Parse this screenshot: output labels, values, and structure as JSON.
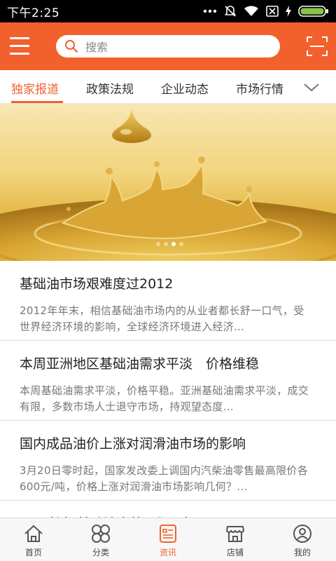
{
  "status_bar": {
    "time": "下午2:25"
  },
  "header": {
    "search_placeholder": "搜索"
  },
  "tabs": [
    {
      "label": "独家报道",
      "active": true
    },
    {
      "label": "政策法规",
      "active": false
    },
    {
      "label": "企业动态",
      "active": false
    },
    {
      "label": "市场行情",
      "active": false
    }
  ],
  "banner": {
    "dots": 4,
    "active_dot": 3
  },
  "news": [
    {
      "title": "基础油市场艰难度过2012",
      "summary": "2012年年末，相信基础油市场内的从业者都长舒一口气，受世界经济环境的影响，全球经济环境进入经济…"
    },
    {
      "title": "本周亚洲地区基础油需求平淡　价格维稳",
      "summary": "本周基础油需求平淡，价格平稳。亚洲基础油需求平淡，成交有限，多数市场人士退守市场，持观望态度…"
    },
    {
      "title": "国内成品油价上涨对润滑油市场的影响",
      "summary": "3月20日零时起，国家发改委上调国内汽柴油零售最高限价各600元/吨，价格上涨对润滑油市场影响几何？…"
    },
    {
      "title": "开局利空 基础油走势一蹶不振",
      "summary": ""
    }
  ],
  "bottom_nav": [
    {
      "label": "首页",
      "icon": "home-icon",
      "active": false
    },
    {
      "label": "分类",
      "icon": "category-icon",
      "active": false
    },
    {
      "label": "资讯",
      "icon": "news-icon",
      "active": true
    },
    {
      "label": "店铺",
      "icon": "store-icon",
      "active": false
    },
    {
      "label": "我的",
      "icon": "profile-icon",
      "active": false
    }
  ],
  "colors": {
    "accent": "#f2612d",
    "status_bar": "#000000"
  }
}
